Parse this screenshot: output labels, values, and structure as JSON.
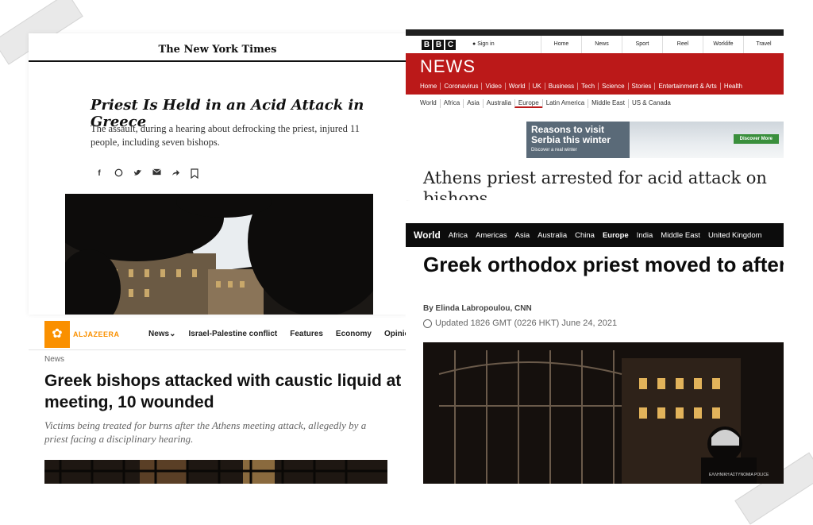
{
  "nyt": {
    "masthead": "The New York Times",
    "headline": "Priest Is Held in an Acid Attack in Greece",
    "summary": "The assault, during a hearing about defrocking the priest, injured 11 people, including seven bishops.",
    "share_icons": [
      "facebook-icon",
      "whatsapp-icon",
      "twitter-icon",
      "email-icon",
      "share-icon",
      "bookmark-icon"
    ]
  },
  "bbc": {
    "logo": [
      "B",
      "B",
      "C"
    ],
    "sign_in": "Sign in",
    "top_nav": [
      "Home",
      "News",
      "Sport",
      "Reel",
      "Worklife",
      "Travel"
    ],
    "brand": "NEWS",
    "nav": [
      "Home",
      "Coronavirus",
      "Video",
      "World",
      "UK",
      "Business",
      "Tech",
      "Science",
      "Stories",
      "Entertainment & Arts",
      "Health"
    ],
    "subnav": [
      "World",
      "Africa",
      "Asia",
      "Australia",
      "Europe",
      "Latin America",
      "Middle East",
      "US & Canada"
    ],
    "subnav_active": "Europe",
    "ad": {
      "title": "Reasons to visit Serbia this winter",
      "subtitle": "Discover a real winter",
      "button": "Discover More"
    },
    "headline": "Athens priest arrested for acid attack on bishops",
    "accent_color": "#bb1919"
  },
  "aljazeera": {
    "brand": "ALJAZEERA",
    "nav": [
      "News",
      "Israel-Palestine conflict",
      "Features",
      "Economy",
      "Opinion"
    ],
    "kicker": "News",
    "headline": "Greek bishops attacked with caustic liquid at meeting, 10 wounded",
    "summary": "Victims being treated for burns after the Athens meeting attack, allegedly by a priest facing a disciplinary hearing.",
    "accent_color": "#fa9000"
  },
  "cnn": {
    "nav": [
      "World",
      "Africa",
      "Americas",
      "Asia",
      "Australia",
      "China",
      "Europe",
      "India",
      "Middle East",
      "United Kingdom"
    ],
    "nav_bold": [
      "World",
      "Europe"
    ],
    "headline": "Greek orthodox priest moved to after attacking group of bishops",
    "byline": "By Elinda Labropoulou, CNN",
    "updated": "Updated 1826 GMT (0226 HKT) June 24, 2021",
    "photo_text": "ΕΛΛΗΝΙΚΗ ΑΣΤΥΝΟΜΙΑ POLICE"
  }
}
